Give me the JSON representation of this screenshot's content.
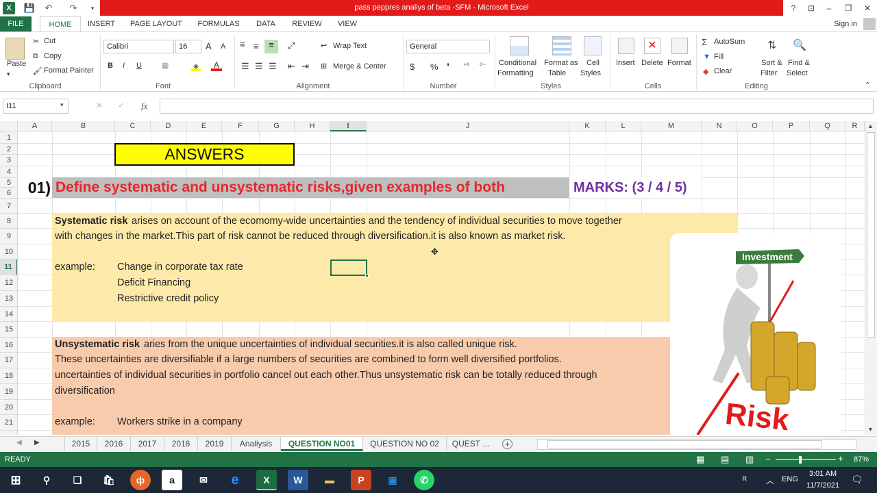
{
  "window": {
    "title": "pass peppres analiys of beta -SFM -  Microsoft Excel",
    "help": "?",
    "minimize": "‒",
    "restore": "❐",
    "close": "✕"
  },
  "ribbon_tabs": [
    "FILE",
    "HOME",
    "INSERT",
    "PAGE LAYOUT",
    "FORMULAS",
    "DATA",
    "REVIEW",
    "VIEW"
  ],
  "sign_in": "Sign in",
  "clipboard": {
    "paste": "Paste",
    "cut": "Cut",
    "copy": "Copy",
    "format_painter": "Format Painter",
    "label": "Clipboard"
  },
  "font": {
    "name": "Calibri",
    "size": "16",
    "bold": "B",
    "italic": "I",
    "underline": "U",
    "label": "Font",
    "grow": "A",
    "shrink": "A"
  },
  "alignment": {
    "wrap": "Wrap Text",
    "merge": "Merge & Center",
    "label": "Alignment"
  },
  "number": {
    "format": "General",
    "currency": "$",
    "percent": "%",
    "comma": "❜",
    "label": "Number"
  },
  "styles": {
    "conditional": "Conditional",
    "conditional2": "Formatting",
    "format_as": "Format as",
    "format_as2": "Table",
    "cell": "Cell",
    "cell2": "Styles",
    "label": "Styles"
  },
  "cells": {
    "insert": "Insert",
    "delete": "Delete",
    "format": "Format",
    "label": "Cells"
  },
  "editing": {
    "autosum": "AutoSum",
    "fill": "Fill",
    "clear": "Clear",
    "sort": "Sort &",
    "sort2": "Filter",
    "find": "Find &",
    "find2": "Select",
    "label": "Editing"
  },
  "formula_bar": {
    "name_box": "I11",
    "fx": "fx",
    "value": ""
  },
  "columns": [
    "A",
    "B",
    "C",
    "D",
    "E",
    "F",
    "G",
    "H",
    "I",
    "J",
    "K",
    "L",
    "M",
    "N",
    "O",
    "P",
    "Q",
    "R"
  ],
  "rows": [
    "1",
    "2",
    "3",
    "4",
    "5",
    "6",
    "7",
    "8",
    "9",
    "10",
    "11",
    "12",
    "13",
    "14",
    "15",
    "16",
    "17",
    "18",
    "19",
    "20",
    "21"
  ],
  "sheet": {
    "answers": "ANSWERS",
    "q_num": "01)",
    "q_text": "Define systematic and unsystematic risks,given examples of both",
    "marks": "MARKS: (3 / 4 / 5)",
    "sys_bold": "Systematic risk",
    "sys_line1": " arises on account of the ecomomy-wide uncertainties and the tendency of individual securities to move together",
    "sys_line2": "with changes in the market.This part of risk cannot be reduced through diversification.it is also known as market risk.",
    "example_label": "example:",
    "sys_ex1": "Change in corporate tax rate",
    "sys_ex2": "Deficit Financing",
    "sys_ex3": "Restrictive credit policy",
    "uns_bold": "Unsystematic risk",
    "uns_line1": " aries from the unique uncertainties of individual securities.it is also called unique risk.",
    "uns_line2": "These uncertainties are diversifiable if a large numbers of securities are combined to form well diversified portfolios.",
    "uns_line3": "uncertainties of individual securities in portfolio cancel out each other.Thus unsystematic risk can be totally reduced through",
    "uns_line4": "diversification",
    "uns_ex1": "Workers strike in a company",
    "img_sign": "Investment",
    "img_word": "Risk"
  },
  "sheet_tabs": [
    "2015",
    "2016",
    "2017",
    "2018",
    "2019",
    "Analiysis",
    "QUESTION NO01",
    "QUESTION NO 02",
    "QUEST ..."
  ],
  "active_sheet": "QUESTION NO01",
  "status": {
    "ready": "READY",
    "zoom": "87%"
  },
  "taskbar": {
    "lang": "ENG",
    "time": "3:01 AM",
    "date": "11/7/2021"
  },
  "colors": {
    "excel_green": "#217346",
    "title_red": "#e31a1a",
    "question_red": "#e8262a",
    "marks_purple": "#7030a0",
    "sys_fill": "#fde9a9",
    "uns_fill": "#f8cbad",
    "answers_fill": "#ffff00",
    "header_gray": "#bfbfbf"
  }
}
